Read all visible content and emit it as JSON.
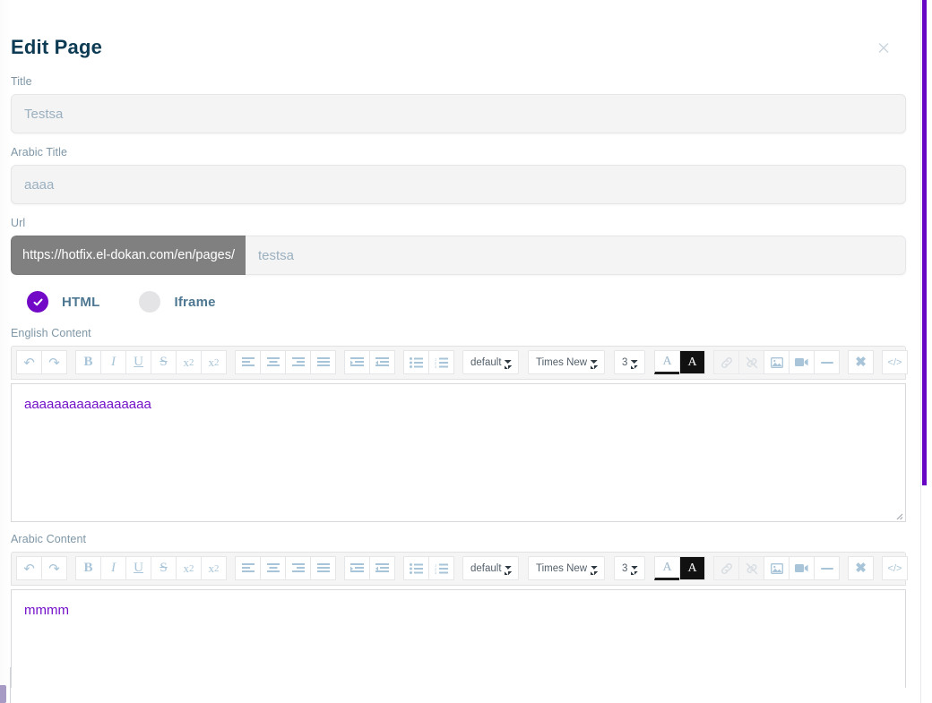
{
  "modal": {
    "title": "Edit Page",
    "close_icon": "close-icon"
  },
  "fields": {
    "title": {
      "label": "Title",
      "value": "",
      "placeholder": "Testsa"
    },
    "arabic_title": {
      "label": "Arabic Title",
      "value": "",
      "placeholder": "aaaa"
    },
    "url": {
      "label": "Url",
      "prefix": "https://hotfix.el-dokan.com/en/pages/",
      "value": "",
      "placeholder": "testsa"
    }
  },
  "page_type": {
    "options": [
      {
        "label": "HTML",
        "selected": true
      },
      {
        "label": "Iframe",
        "selected": false
      }
    ],
    "accent_color": "#7209c6",
    "unchecked_color": "#e4e4e6"
  },
  "editors": {
    "english": {
      "label": "English Content",
      "content": "aaaaaaaaaaaaaaaaa",
      "content_color": "#7312c9"
    },
    "arabic": {
      "label": "Arabic Content",
      "content": "mmmm",
      "content_color": "#7312c9"
    }
  },
  "toolbar": {
    "groups": [
      {
        "name": "history",
        "buttons": [
          {
            "name": "undo-icon",
            "glyph": "↶",
            "label": "Undo"
          },
          {
            "name": "redo-icon",
            "glyph": "↷",
            "label": "Redo"
          }
        ]
      },
      {
        "name": "text-style",
        "buttons": [
          {
            "name": "bold-icon",
            "glyph": "B",
            "label": "Bold"
          },
          {
            "name": "italic-icon",
            "glyph": "I",
            "label": "Italic"
          },
          {
            "name": "underline-icon",
            "glyph": "U",
            "label": "Underline"
          },
          {
            "name": "strikethrough-icon",
            "glyph": "S",
            "label": "Strikethrough"
          },
          {
            "name": "subscript-icon",
            "glyph": "x2",
            "label": "Subscript"
          },
          {
            "name": "superscript-icon",
            "glyph": "x2",
            "label": "Superscript"
          }
        ]
      },
      {
        "name": "alignment",
        "buttons": [
          {
            "name": "align-left-icon",
            "label": "Align left"
          },
          {
            "name": "align-center-icon",
            "label": "Align center"
          },
          {
            "name": "align-right-icon",
            "label": "Align right"
          },
          {
            "name": "align-justify-icon",
            "label": "Justify"
          }
        ]
      },
      {
        "name": "indentation",
        "buttons": [
          {
            "name": "indent-icon",
            "label": "Increase indent"
          },
          {
            "name": "outdent-icon",
            "label": "Decrease indent"
          }
        ]
      },
      {
        "name": "lists",
        "buttons": [
          {
            "name": "unordered-list-icon",
            "label": "Bulleted list"
          },
          {
            "name": "ordered-list-icon",
            "label": "Numbered list"
          }
        ]
      },
      {
        "name": "colors",
        "buttons": [
          {
            "name": "text-color-icon",
            "glyph": "A",
            "label": "Text color"
          },
          {
            "name": "background-color-icon",
            "glyph": "A",
            "label": "Background color"
          }
        ]
      },
      {
        "name": "insert",
        "buttons": [
          {
            "name": "link-icon",
            "label": "Insert link",
            "disabled": true
          },
          {
            "name": "unlink-icon",
            "label": "Remove link",
            "disabled": true
          },
          {
            "name": "image-icon",
            "label": "Insert image",
            "disabled": false
          },
          {
            "name": "video-icon",
            "label": "Insert video",
            "disabled": false
          },
          {
            "name": "horizontal-rule-icon",
            "label": "Horizontal rule",
            "disabled": false
          }
        ]
      },
      {
        "name": "misc",
        "buttons": [
          {
            "name": "clear-formatting-icon",
            "glyph": "✖",
            "label": "Clear formatting"
          }
        ]
      },
      {
        "name": "source",
        "buttons": [
          {
            "name": "code-view-icon",
            "glyph": "</>",
            "label": "Code view"
          }
        ]
      }
    ],
    "selects": {
      "style": {
        "name": "paragraph-style-select",
        "value": "default"
      },
      "font": {
        "name": "font-family-select",
        "value": "Times New"
      },
      "font_size": {
        "name": "font-size-select",
        "value": "3"
      }
    }
  },
  "scrollbar": {
    "thumb_color": "#6805c4"
  }
}
